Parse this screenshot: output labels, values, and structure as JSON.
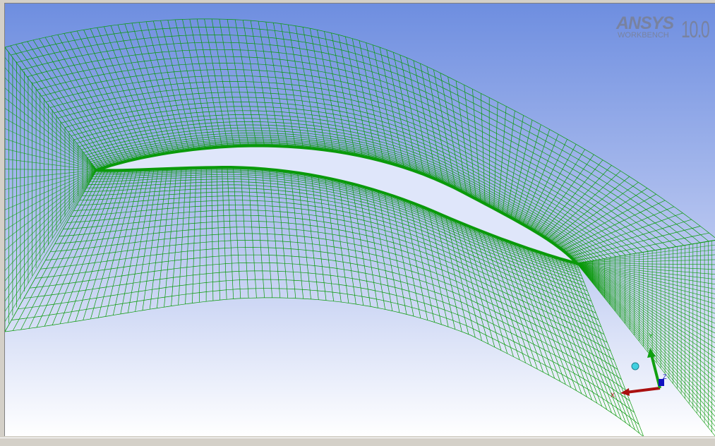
{
  "viewer": {
    "logo": {
      "brand": "ANSYS",
      "product": "WORKBENCH",
      "version": "10.0"
    },
    "mesh": {
      "color": "#0a9a0a",
      "description_visible": false
    },
    "background": {
      "top_color": "#6e8ee0",
      "bottom_color": "#ffffff"
    },
    "triad": {
      "x_label": "X",
      "y_label": "Y",
      "z_label": "Z",
      "x_color": "#aa1010",
      "y_color": "#10a010",
      "z_color": "#1010c0",
      "iso_ball_color": "#40d0e0"
    }
  }
}
